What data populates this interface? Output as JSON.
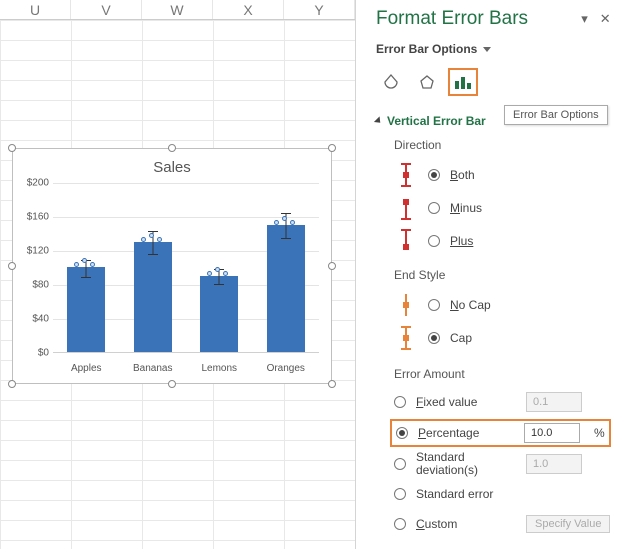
{
  "columns": [
    "U",
    "V",
    "W",
    "X",
    "Y"
  ],
  "panel": {
    "title": "Format Error Bars",
    "dropdown_label": "Error Bar Options",
    "tooltip": "Error Bar Options",
    "section": "Vertical Error Bar",
    "direction_label": "Direction",
    "direction": {
      "both": "Both",
      "minus": "Minus",
      "plus": "Plus"
    },
    "endstyle_label": "End Style",
    "endstyle": {
      "nocap": "No Cap",
      "cap": "Cap"
    },
    "amount_label": "Error Amount",
    "amount": {
      "fixed": "Fixed value",
      "fixed_val": "0.1",
      "percentage": "Percentage",
      "percentage_val": "10.0",
      "percent_suffix": "%",
      "stddev": "Standard deviation(s)",
      "stddev_val": "1.0",
      "stderr": "Standard error",
      "custom": "Custom",
      "specify": "Specify Value"
    }
  },
  "chart_data": {
    "type": "bar",
    "title": "Sales",
    "categories": [
      "Apples",
      "Bananas",
      "Lemons",
      "Oranges"
    ],
    "values": [
      100,
      130,
      90,
      150
    ],
    "ylabel": "",
    "ylim": [
      0,
      200
    ],
    "yticks": [
      0,
      40,
      80,
      120,
      160,
      200
    ],
    "ytick_labels": [
      "$0",
      "$40",
      "$80",
      "$120",
      "$160",
      "$200"
    ],
    "error_percentage": 10.0
  }
}
